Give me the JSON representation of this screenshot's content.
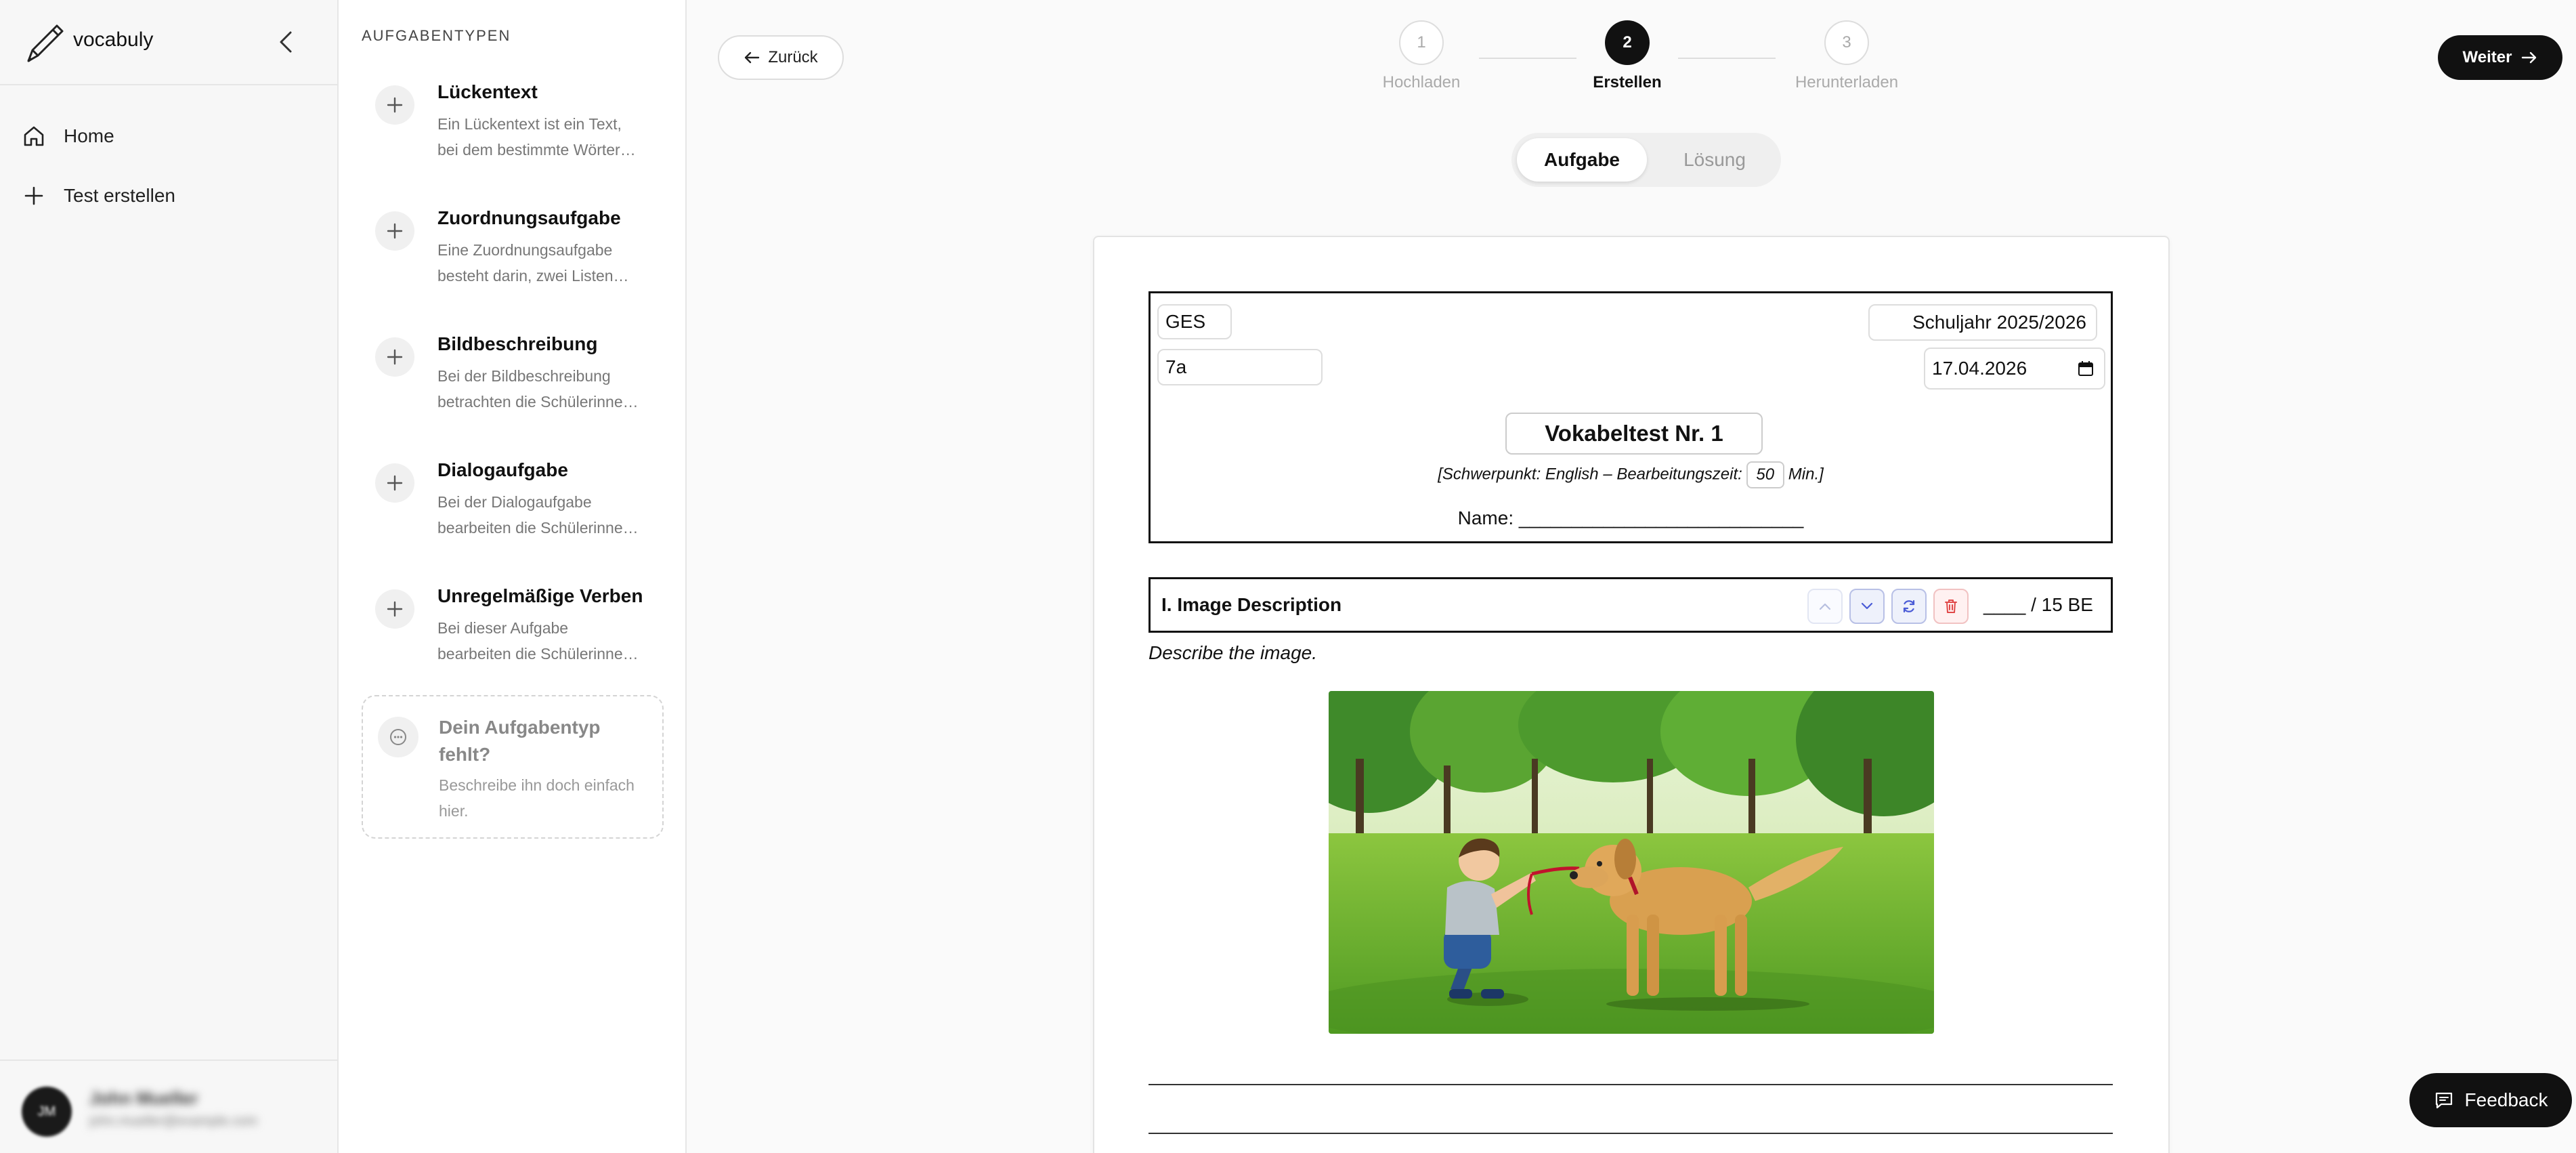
{
  "app": {
    "name": "vocabuly"
  },
  "nav": {
    "home": "Home",
    "create_test": "Test erstellen"
  },
  "user": {
    "name": "John Mueller",
    "email": "john.mueller@example.com",
    "initials": "JM"
  },
  "types_panel": {
    "heading": "AUFGABENTYPEN",
    "items": [
      {
        "title": "Lückentext",
        "desc1": "Ein Lückentext ist ein Text,",
        "desc2": "bei dem bestimmte Wörter…"
      },
      {
        "title": "Zuordnungsaufgabe",
        "desc1": "Eine Zuordnungsaufgabe",
        "desc2": "besteht darin, zwei Listen…"
      },
      {
        "title": "Bildbeschreibung",
        "desc1": "Bei der Bildbeschreibung",
        "desc2": "betrachten die Schülerinne…"
      },
      {
        "title": "Dialogaufgabe",
        "desc1": "Bei der Dialogaufgabe",
        "desc2": "bearbeiten die Schülerinne…"
      },
      {
        "title": "Unregelmäßige Verben",
        "desc1": "Bei dieser Aufgabe",
        "desc2": "bearbeiten die Schülerinne…"
      }
    ],
    "missing": {
      "title": "Dein Aufgabentyp fehlt?",
      "desc": "Beschreibe ihn doch einfach hier."
    }
  },
  "toolbar": {
    "back_label": "Zurück",
    "next_label": "Weiter"
  },
  "stepper": {
    "steps": [
      {
        "number": "1",
        "label": "Hochladen",
        "state": "inactive"
      },
      {
        "number": "2",
        "label": "Erstellen",
        "state": "active"
      },
      {
        "number": "3",
        "label": "Herunterladen",
        "state": "inactive"
      }
    ]
  },
  "view_toggle": {
    "task": "Aufgabe",
    "solution": "Lösung",
    "selected": "Aufgabe"
  },
  "sheet": {
    "school": "GES",
    "class": "7a",
    "school_year": "Schuljahr 2025/2026",
    "date": "17.04.2026",
    "title": "Vokabeltest Nr. 1",
    "meta_prefix": "[Schwerpunkt:  English  – Bearbeitungszeit:",
    "duration": "50",
    "meta_suffix": "Min.]",
    "name_line": "Name: ___________________________"
  },
  "task": {
    "title": "I. Image Description",
    "points": "____ / 15 BE",
    "instruction": "Describe the image."
  },
  "feedback": {
    "label": "Feedback"
  },
  "colors": {
    "primary": "#111111",
    "accent_blue": "#4a5bd6",
    "danger": "#e04848"
  }
}
